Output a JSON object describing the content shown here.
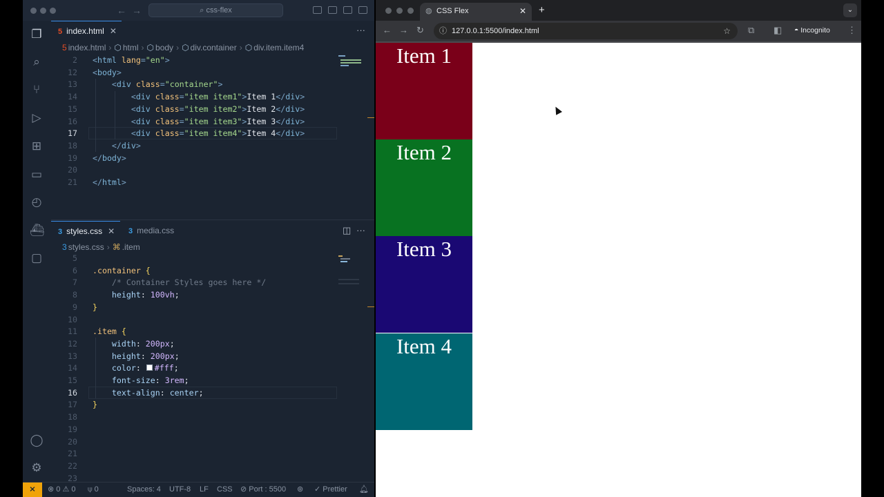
{
  "vscode": {
    "command_center": "css-flex",
    "top_editor": {
      "tabs": [
        {
          "label": "index.html",
          "icon": "html-file-icon",
          "active": true
        }
      ],
      "breadcrumbs": [
        "index.html",
        "html",
        "body",
        "div.container",
        "div.item.item4"
      ],
      "lines": [
        {
          "num": "2",
          "tokens": [
            {
              "c": "t-pun",
              "t": "<"
            },
            {
              "c": "t-tag",
              "t": "html"
            },
            {
              "c": "t-attr",
              "t": " lang"
            },
            {
              "c": "t-pun",
              "t": "="
            },
            {
              "c": "t-str",
              "t": "\"en\""
            },
            {
              "c": "t-pun",
              "t": ">"
            }
          ]
        },
        {
          "num": "12",
          "tokens": [
            {
              "c": "t-pun",
              "t": "<"
            },
            {
              "c": "t-tag",
              "t": "body"
            },
            {
              "c": "t-pun",
              "t": ">"
            }
          ]
        },
        {
          "num": "13",
          "tokens": [
            {
              "c": "t-txt",
              "t": "    "
            },
            {
              "c": "t-pun",
              "t": "<"
            },
            {
              "c": "t-tag",
              "t": "div"
            },
            {
              "c": "t-attr",
              "t": " class"
            },
            {
              "c": "t-pun",
              "t": "="
            },
            {
              "c": "t-str",
              "t": "\"container\""
            },
            {
              "c": "t-pun",
              "t": ">"
            }
          ]
        },
        {
          "num": "14",
          "tokens": [
            {
              "c": "t-txt",
              "t": "        "
            },
            {
              "c": "t-pun",
              "t": "<"
            },
            {
              "c": "t-tag",
              "t": "div"
            },
            {
              "c": "t-attr",
              "t": " class"
            },
            {
              "c": "t-pun",
              "t": "="
            },
            {
              "c": "t-str",
              "t": "\"item item1\""
            },
            {
              "c": "t-pun",
              "t": ">"
            },
            {
              "c": "t-txt",
              "t": "Item 1"
            },
            {
              "c": "t-pun",
              "t": "</"
            },
            {
              "c": "t-tag",
              "t": "div"
            },
            {
              "c": "t-pun",
              "t": ">"
            }
          ]
        },
        {
          "num": "15",
          "tokens": [
            {
              "c": "t-txt",
              "t": "        "
            },
            {
              "c": "t-pun",
              "t": "<"
            },
            {
              "c": "t-tag",
              "t": "div"
            },
            {
              "c": "t-attr",
              "t": " class"
            },
            {
              "c": "t-pun",
              "t": "="
            },
            {
              "c": "t-str",
              "t": "\"item item2\""
            },
            {
              "c": "t-pun",
              "t": ">"
            },
            {
              "c": "t-txt",
              "t": "Item 2"
            },
            {
              "c": "t-pun",
              "t": "</"
            },
            {
              "c": "t-tag",
              "t": "div"
            },
            {
              "c": "t-pun",
              "t": ">"
            }
          ]
        },
        {
          "num": "16",
          "tokens": [
            {
              "c": "t-txt",
              "t": "        "
            },
            {
              "c": "t-pun",
              "t": "<"
            },
            {
              "c": "t-tag",
              "t": "div"
            },
            {
              "c": "t-attr",
              "t": " class"
            },
            {
              "c": "t-pun",
              "t": "="
            },
            {
              "c": "t-str",
              "t": "\"item item3\""
            },
            {
              "c": "t-pun",
              "t": ">"
            },
            {
              "c": "t-txt",
              "t": "Item 3"
            },
            {
              "c": "t-pun",
              "t": "</"
            },
            {
              "c": "t-tag",
              "t": "div"
            },
            {
              "c": "t-pun",
              "t": ">"
            }
          ]
        },
        {
          "num": "17",
          "current": true,
          "tokens": [
            {
              "c": "t-txt",
              "t": "        "
            },
            {
              "c": "t-pun",
              "t": "<"
            },
            {
              "c": "t-tag",
              "t": "div"
            },
            {
              "c": "t-attr",
              "t": " class"
            },
            {
              "c": "t-pun",
              "t": "="
            },
            {
              "c": "t-str",
              "t": "\"item item4\""
            },
            {
              "c": "t-pun",
              "t": ">"
            },
            {
              "c": "t-txt",
              "t": "Item 4"
            },
            {
              "c": "t-pun",
              "t": "</"
            },
            {
              "c": "t-tag",
              "t": "div"
            },
            {
              "c": "t-pun",
              "t": ">"
            }
          ]
        },
        {
          "num": "18",
          "tokens": [
            {
              "c": "t-txt",
              "t": "    "
            },
            {
              "c": "t-pun",
              "t": "</"
            },
            {
              "c": "t-tag",
              "t": "div"
            },
            {
              "c": "t-pun",
              "t": ">"
            }
          ]
        },
        {
          "num": "19",
          "tokens": [
            {
              "c": "t-pun",
              "t": "</"
            },
            {
              "c": "t-tag",
              "t": "body"
            },
            {
              "c": "t-pun",
              "t": ">"
            }
          ]
        },
        {
          "num": "20",
          "tokens": []
        },
        {
          "num": "21",
          "tokens": [
            {
              "c": "t-pun",
              "t": "</"
            },
            {
              "c": "t-tag",
              "t": "html"
            },
            {
              "c": "t-pun",
              "t": ">"
            }
          ]
        }
      ]
    },
    "bottom_editor": {
      "tabs": [
        {
          "label": "styles.css",
          "icon": "css-file-icon",
          "active": true
        },
        {
          "label": "media.css",
          "icon": "css-file-icon",
          "active": false
        }
      ],
      "breadcrumbs": [
        "styles.css",
        ".item"
      ],
      "lines": [
        {
          "num": "5",
          "tokens": []
        },
        {
          "num": "6",
          "tokens": [
            {
              "c": "t-sel",
              "t": ".container"
            },
            {
              "c": "t-txt",
              "t": " "
            },
            {
              "c": "t-brace",
              "t": "{"
            }
          ]
        },
        {
          "num": "7",
          "tokens": [
            {
              "c": "t-txt",
              "t": "    "
            },
            {
              "c": "t-com",
              "t": "/* Container Styles goes here */"
            }
          ]
        },
        {
          "num": "8",
          "tokens": [
            {
              "c": "t-txt",
              "t": "    "
            },
            {
              "c": "t-prop",
              "t": "height"
            },
            {
              "c": "t-txt",
              "t": ": "
            },
            {
              "c": "t-num",
              "t": "100vh"
            },
            {
              "c": "t-txt",
              "t": ";"
            }
          ]
        },
        {
          "num": "9",
          "tokens": [
            {
              "c": "t-brace",
              "t": "}"
            }
          ]
        },
        {
          "num": "10",
          "tokens": []
        },
        {
          "num": "11",
          "tokens": [
            {
              "c": "t-sel",
              "t": ".item"
            },
            {
              "c": "t-txt",
              "t": " "
            },
            {
              "c": "t-brace",
              "t": "{"
            }
          ]
        },
        {
          "num": "12",
          "tokens": [
            {
              "c": "t-txt",
              "t": "    "
            },
            {
              "c": "t-prop",
              "t": "width"
            },
            {
              "c": "t-txt",
              "t": ": "
            },
            {
              "c": "t-num",
              "t": "200px"
            },
            {
              "c": "t-txt",
              "t": ";"
            }
          ]
        },
        {
          "num": "13",
          "tokens": [
            {
              "c": "t-txt",
              "t": "    "
            },
            {
              "c": "t-prop",
              "t": "height"
            },
            {
              "c": "t-txt",
              "t": ": "
            },
            {
              "c": "t-num",
              "t": "200px"
            },
            {
              "c": "t-txt",
              "t": ";"
            }
          ]
        },
        {
          "num": "14",
          "tokens": [
            {
              "c": "t-txt",
              "t": "    "
            },
            {
              "c": "t-prop",
              "t": "color"
            },
            {
              "c": "t-txt",
              "t": ": "
            },
            {
              "c": "swatch",
              "t": "#ffffff"
            },
            {
              "c": "t-num",
              "t": "#fff"
            },
            {
              "c": "t-txt",
              "t": ";"
            }
          ]
        },
        {
          "num": "15",
          "tokens": [
            {
              "c": "t-txt",
              "t": "    "
            },
            {
              "c": "t-prop",
              "t": "font-size"
            },
            {
              "c": "t-txt",
              "t": ": "
            },
            {
              "c": "t-num",
              "t": "3rem"
            },
            {
              "c": "t-txt",
              "t": ";"
            }
          ]
        },
        {
          "num": "16",
          "current": true,
          "tokens": [
            {
              "c": "t-txt",
              "t": "    "
            },
            {
              "c": "t-prop",
              "t": "text-align"
            },
            {
              "c": "t-txt",
              "t": ": "
            },
            {
              "c": "t-prop",
              "t": "center"
            },
            {
              "c": "t-txt",
              "t": ";"
            }
          ]
        },
        {
          "num": "17",
          "tokens": [
            {
              "c": "t-brace",
              "t": "}"
            }
          ]
        },
        {
          "num": "18",
          "tokens": []
        },
        {
          "num": "19",
          "tokens": []
        },
        {
          "num": "20",
          "tokens": []
        },
        {
          "num": "21",
          "tokens": []
        },
        {
          "num": "22",
          "tokens": []
        },
        {
          "num": "23",
          "tokens": []
        }
      ]
    },
    "status_bar": {
      "errors": "0",
      "warnings": "0",
      "ports": "0",
      "spaces": "Spaces: 4",
      "encoding": "UTF-8",
      "eol": "LF",
      "language": "CSS",
      "port": "Port : 5500",
      "formatter": "Prettier"
    }
  },
  "browser": {
    "tab_title": "CSS Flex",
    "url": "127.0.0.1:5500/index.html",
    "incognito_label": "Incognito",
    "items": [
      {
        "label": "Item 1",
        "color": "#7a0019"
      },
      {
        "label": "Item 2",
        "color": "#087221"
      },
      {
        "label": "Item 3",
        "color": "#1a0873"
      },
      {
        "label": "Item 4",
        "color": "#006672"
      }
    ]
  }
}
